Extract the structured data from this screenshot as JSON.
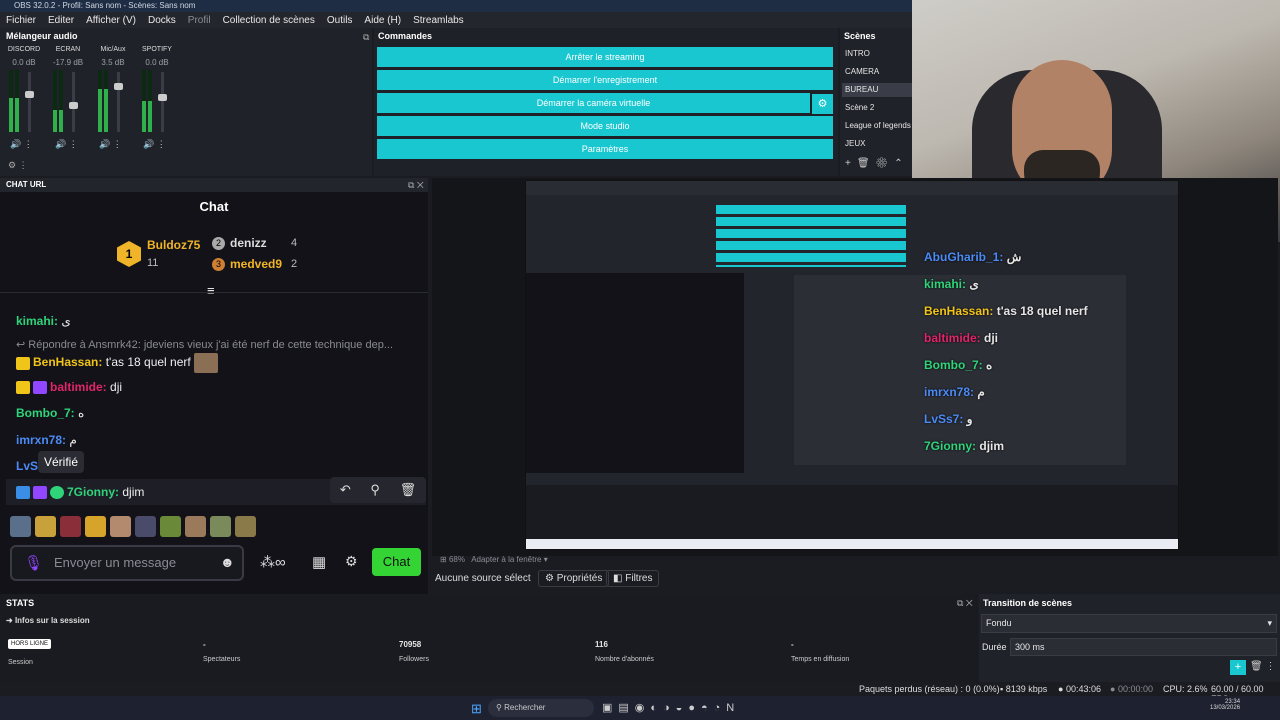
{
  "window_title": "OBS 32.0.2 - Profil: Sans nom - Scènes: Sans nom",
  "menu": [
    "Fichier",
    "Editer",
    "Afficher (V)",
    "Docks",
    "Profil",
    "Collection de scènes",
    "Outils",
    "Aide (H)",
    "Streamlabs"
  ],
  "mixer": {
    "title": "Mélangeur audio",
    "channels": [
      {
        "name": "DISCORD",
        "db": "0.0 dB",
        "level": 0.55
      },
      {
        "name": "ECRAN",
        "db": "-17.9 dB",
        "level": 0.35
      },
      {
        "name": "Mic/Aux",
        "db": "3.5 dB",
        "level": 0.7
      },
      {
        "name": "SPOTIFY",
        "db": "0.0 dB",
        "level": 0.5
      }
    ]
  },
  "commands": {
    "title": "Commandes",
    "buttons": [
      "Arrêter le streaming",
      "Démarrer l'enregistrement",
      "Démarrer la caméra virtuelle",
      "Mode studio",
      "Paramètres"
    ]
  },
  "scenes": {
    "title": "Scènes",
    "items": [
      "INTRO",
      "CAMERA",
      "BUREAU",
      "Scène 2",
      "League of legends",
      "JEUX"
    ],
    "selected": "BUREAU"
  },
  "chat_dock": {
    "title": "CHAT URL",
    "header": "Chat",
    "leaderboard": {
      "first": {
        "name": "Buldoz75",
        "rank": "1",
        "count": "11"
      },
      "second": {
        "name": "denizz",
        "rank": "2",
        "count": "4"
      },
      "third": {
        "name": "medved9",
        "rank": "3",
        "count": "2"
      }
    },
    "messages": [
      {
        "user": "kimahi:",
        "text": "ى",
        "color": "#2fd47a"
      },
      {
        "reply": "Répondre à Ansmrk42: jdeviens vieux j'ai été nerf de cette technique dep..."
      },
      {
        "user": "BenHassan:",
        "text": "t'as 18 quel nerf",
        "color": "#f0c419"
      },
      {
        "user": "baltimide:",
        "text": "dji",
        "color": "#e0256a"
      },
      {
        "user": "Bombo_7:",
        "text": "ه",
        "color": "#2fd47a"
      },
      {
        "user": "imrxn78:",
        "text": "م",
        "color": "#4b8bf5"
      },
      {
        "user": "LvS",
        "text": "",
        "color": "#4b8bf5"
      },
      {
        "user": "7Gionny:",
        "text": "djim",
        "color": "#2fd47a"
      }
    ],
    "tooltip": "Vérifié",
    "input_placeholder": "Envoyer un message",
    "chat_button": "Chat"
  },
  "overlay_chat": [
    {
      "user": "AbuGharib_1:",
      "text": "ش",
      "color": "#4b8bf5"
    },
    {
      "user": "kimahi:",
      "text": "ى",
      "color": "#2fd47a"
    },
    {
      "user": "BenHassan:",
      "text": "t'as 18 quel nerf",
      "color": "#f0c419"
    },
    {
      "user": "baltimide:",
      "text": "dji",
      "color": "#e0256a"
    },
    {
      "user": "Bombo_7:",
      "text": "ه",
      "color": "#2fd47a"
    },
    {
      "user": "imrxn78:",
      "text": "م",
      "color": "#4b8bf5"
    },
    {
      "user": "LvSs7:",
      "text": "و",
      "color": "#4b8bf5"
    },
    {
      "user": "7Gionny:",
      "text": "djim",
      "color": "#2fd47a"
    }
  ],
  "preview_bar": {
    "zoom": "68%",
    "fit": "Adapter à la fenêtre"
  },
  "source_bar": {
    "no_source": "Aucune source sélect",
    "properties": "Propriétés",
    "filters": "Filtres"
  },
  "stats": {
    "title": "STATS",
    "subtitle": "Infos sur la session",
    "offline": "HORS LIGNE",
    "cols": [
      {
        "value": "",
        "label": "Session"
      },
      {
        "value": "-",
        "label": "Spectateurs"
      },
      {
        "value": "70958",
        "label": "Followers"
      },
      {
        "value": "116",
        "label": "Nombre d'abonnés"
      },
      {
        "value": "-",
        "label": "Temps en diffusion"
      }
    ]
  },
  "transition": {
    "title": "Transition de scènes",
    "type": "Fondu",
    "duration_label": "Durée",
    "duration": "300 ms"
  },
  "status": {
    "dropped": "Paquets perdus (réseau) : 0 (0.0%)",
    "bitrate": "8139 kbps",
    "stream_time": "00:43:06",
    "rec_time": "00:00:00",
    "cpu": "CPU: 2.6%",
    "fps": "60.00 / 60.00 FPS"
  },
  "taskbar": {
    "search": "Rechercher",
    "time": "23:34",
    "date": "13/03/2026"
  }
}
